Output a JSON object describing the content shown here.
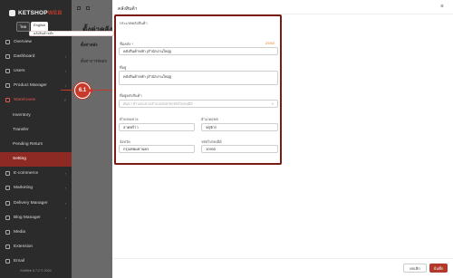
{
  "sidebar": {
    "logo_text": "KETSHOP",
    "logo_suffix": "WEB",
    "lang_options": [
      "ไทย",
      "English"
    ],
    "items": [
      {
        "label": "Overview",
        "icon": "overview-icon",
        "chevron": ""
      },
      {
        "label": "Dashboard",
        "icon": "dashboard-icon",
        "chevron": "›"
      },
      {
        "label": "Users",
        "icon": "users-icon",
        "chevron": "›"
      },
      {
        "label": "Product Manager",
        "icon": "box-icon",
        "chevron": "›"
      },
      {
        "label": "Warehouse",
        "icon": "warehouse-icon",
        "chevron": "˅"
      },
      {
        "label": "Inventory",
        "icon": "",
        "chevron": ""
      },
      {
        "label": "Transfer",
        "icon": "",
        "chevron": ""
      },
      {
        "label": "Pending Return",
        "icon": "",
        "chevron": ""
      },
      {
        "label": "Setting",
        "icon": "",
        "chevron": ""
      },
      {
        "label": "E-commerce",
        "icon": "cart-icon",
        "chevron": "›"
      },
      {
        "label": "Marketing",
        "icon": "megaphone-icon",
        "chevron": "›"
      },
      {
        "label": "Delivery Manager",
        "icon": "truck-icon",
        "chevron": "›"
      },
      {
        "label": "Blog Manager",
        "icon": "blog-icon",
        "chevron": "›"
      },
      {
        "label": "Media",
        "icon": "media-icon",
        "chevron": ""
      },
      {
        "label": "Extension",
        "icon": "extension-icon",
        "chevron": ""
      },
      {
        "label": "Email",
        "icon": "mail-icon",
        "chevron": ""
      }
    ],
    "version": "KetWeb 5.7.2 © 2024"
  },
  "background": {
    "title": "ตั้งค่าคลัง",
    "tab1": "ตั้งค่าคลัง",
    "tab2": "ตั้งค่าการจัดส่ง"
  },
  "drawer": {
    "title": "คลังสินค้า",
    "close": "×",
    "overlay_label": "คลังสินค้าหลัก",
    "fields": {
      "code_label": "ประเภทคลังสินค้า",
      "name_label": "ชื่อคลัง",
      "name_value": "คลังสินค้าหลัก (สำนักงานใหญ่)",
      "counter": "29/50",
      "address_label": "ที่อยู่",
      "address_value": "คลังสินค้าหลัก (สำนักงานใหญ่)",
      "location_label": "ที่อยู่คลังสินค้า",
      "location_placeholder": "ค้นหา ตำบล/แขวง/อำเภอ/จังหวัด/รหัสไปรษณีย์",
      "subdistrict_label": "ตำบล/แขวง",
      "subdistrict_value": "ลาดพร้าว",
      "district_label": "อำเภอ/เขต",
      "district_value": "จตุจักร",
      "province_label": "จังหวัด",
      "province_value": "กรุงเทพมหานคร",
      "postcode_label": "รหัสไปรษณีย์",
      "postcode_value": "10900"
    },
    "cancel_label": "ยกเลิก",
    "save_label": "บันทึก"
  },
  "callout": "6.1"
}
